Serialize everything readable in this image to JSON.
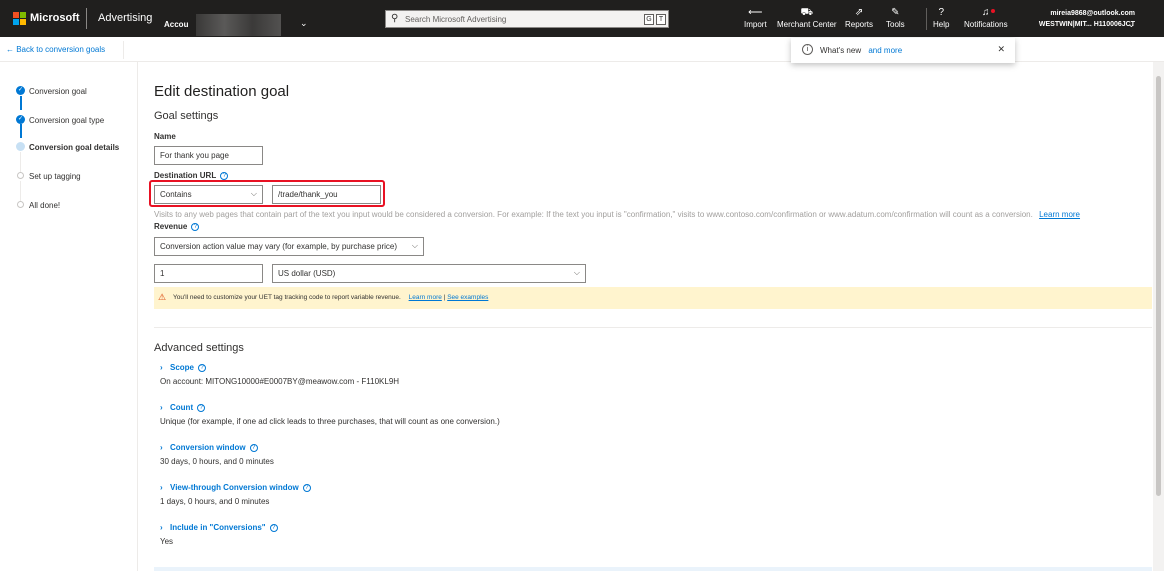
{
  "topbar": {
    "brand": "Microsoft",
    "product": "Advertising",
    "account_prefix": "Accou",
    "search_placeholder": "Search Microsoft Advertising",
    "search_key1": "G",
    "search_key2": "T",
    "nav": {
      "import": "Import",
      "merchant_center": "Merchant Center",
      "reports": "Reports",
      "tools": "Tools",
      "help": "Help",
      "notifications": "Notifications"
    },
    "user_email": "mireia9868@outlook.com",
    "user_account": "WESTWIN|MIT...    H110006JCT"
  },
  "subheader": {
    "back_label": "← Back to conversion goals"
  },
  "toast": {
    "text": "What's new",
    "link": "and more"
  },
  "steps": [
    {
      "label": "Conversion goal",
      "state": "done"
    },
    {
      "label": "Conversion goal type",
      "state": "done"
    },
    {
      "label": "Conversion goal details",
      "state": "current"
    },
    {
      "label": "Set up tagging",
      "state": "todo"
    },
    {
      "label": "All done!",
      "state": "todo"
    }
  ],
  "main": {
    "title": "Edit destination goal",
    "goal_settings": "Goal settings",
    "name_label": "Name",
    "name_value": "For thank you page",
    "dest_url_label": "Destination URL",
    "operator_value": "Contains",
    "url_value": "/trade/thank_you",
    "hint_text": "Visits to any web pages that contain part of the text you input would be considered a conversion. For example: If the text you input is \"confirmation,\" visits to www.contoso.com/confirmation or www.adatum.com/confirmation will count as a conversion.",
    "hint_link": "Learn more",
    "revenue_label": "Revenue",
    "revenue_option": "Conversion action value may vary (for example, by purchase price)",
    "revenue_value": "1",
    "currency_value": "US dollar (USD)",
    "warning_text": "You'll need to customize your UET tag tracking code to report variable revenue.",
    "warning_link1": "Learn more",
    "warning_sep": "|",
    "warning_link2": "See examples",
    "advanced_settings": "Advanced settings",
    "advanced": [
      {
        "title": "Scope",
        "value": "On account: MITONG10000#E0007BY@meawow.com - F110KL9H"
      },
      {
        "title": "Count",
        "value": "Unique (for example, if one ad click leads to three purchases, that will count as one conversion.)"
      },
      {
        "title": "Conversion window",
        "value": "30 days, 0 hours, and 0 minutes"
      },
      {
        "title": "View-through Conversion window",
        "value": "1 days, 0 hours, and 0 minutes"
      },
      {
        "title": "Include in \"Conversions\"",
        "value": "Yes"
      }
    ]
  }
}
